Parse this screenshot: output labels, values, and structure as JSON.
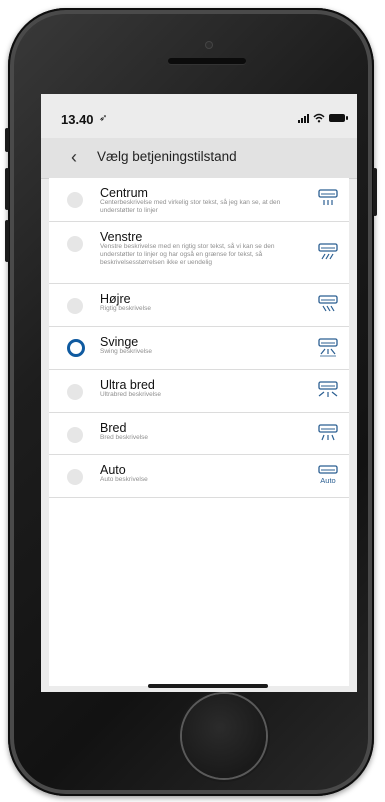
{
  "status": {
    "time": "13.40"
  },
  "nav": {
    "title": "Vælg betjeningstilstand"
  },
  "modes": [
    {
      "label": "Centrum",
      "description": "Centerbeskrivelse med virkelig stor tekst, så jeg kan se, at den understøtter to linjer",
      "icon": "ac-vent-center-icon",
      "selected": false
    },
    {
      "label": "Venstre",
      "description": "Venstre beskrivelse med en rigtig stor tekst, så vi kan se den understøtter to linjer og har også en grænse for tekst, så beskrivelsesstørrelsen ikke er uendelig",
      "icon": "ac-vent-left-icon",
      "selected": false
    },
    {
      "label": "Højre",
      "description": "Rigtig beskrivelse",
      "icon": "ac-vent-right-icon",
      "selected": false
    },
    {
      "label": "Svinge",
      "description": "Swing beskrivelse",
      "icon": "ac-vent-swing-icon",
      "selected": true
    },
    {
      "label": "Ultra bred",
      "description": "Ultrabred beskrivelse",
      "icon": "ac-vent-ultrawide-icon",
      "selected": false
    },
    {
      "label": "Bred",
      "description": "Bred beskrivelse",
      "icon": "ac-vent-wide-icon",
      "selected": false
    },
    {
      "label": "Auto",
      "description": "Auto beskrivelse",
      "icon": "ac-auto-icon",
      "icon_text": "Auto",
      "selected": false
    }
  ],
  "colors": {
    "accent": "#0f5aa0",
    "icon": "#2b5f92"
  }
}
